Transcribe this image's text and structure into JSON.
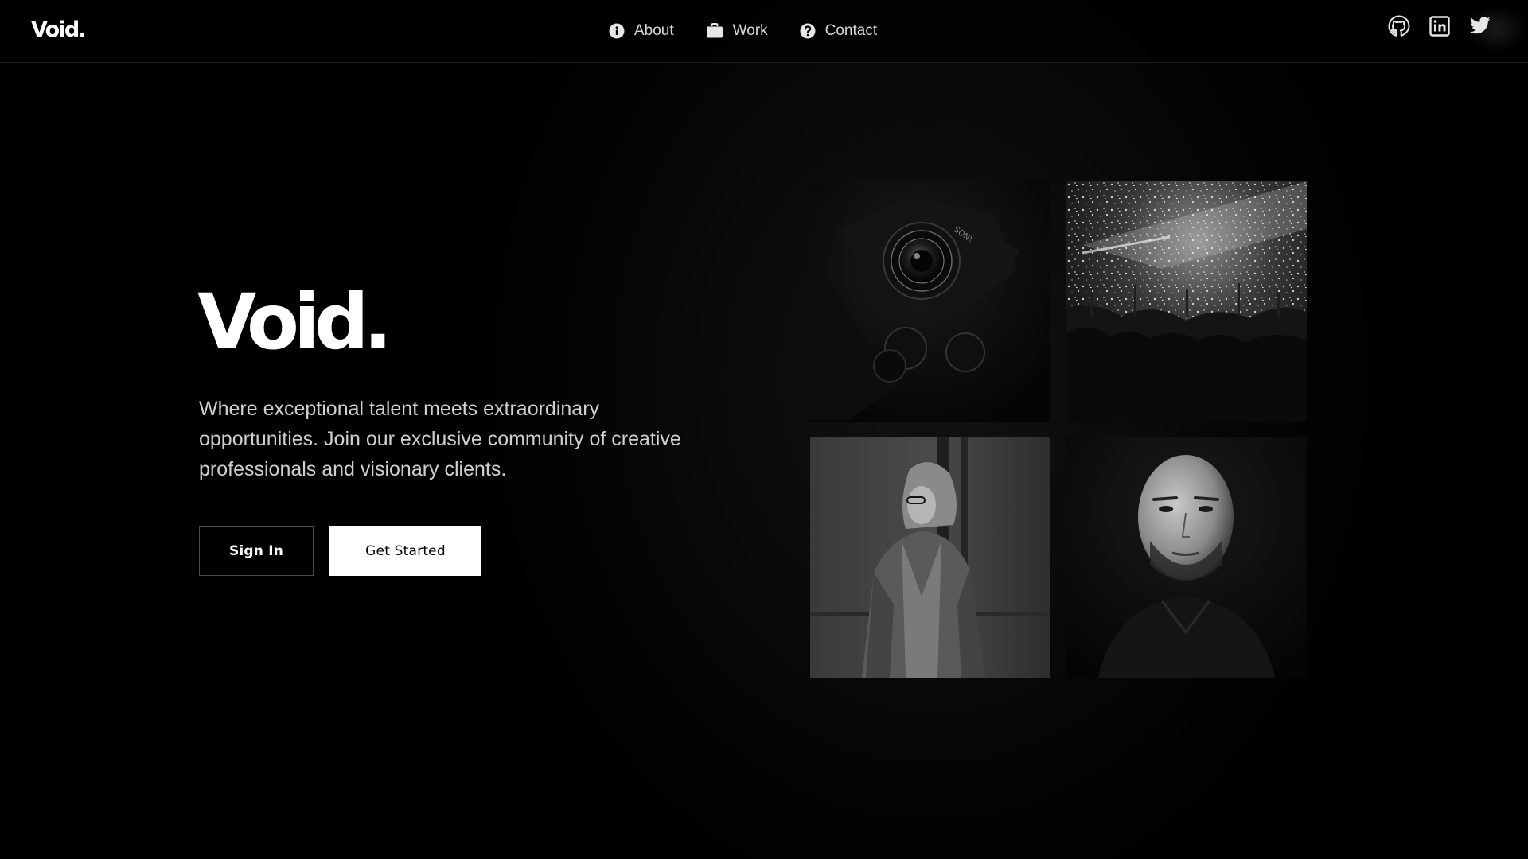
{
  "brand": {
    "logo_text": "Void."
  },
  "nav": {
    "items": [
      {
        "label": "About",
        "icon": "info-icon"
      },
      {
        "label": "Work",
        "icon": "briefcase-icon"
      },
      {
        "label": "Contact",
        "icon": "question-icon"
      }
    ]
  },
  "socials": [
    {
      "icon": "github-icon"
    },
    {
      "icon": "linkedin-icon"
    },
    {
      "icon": "twitter-icon"
    }
  ],
  "hero": {
    "title": "Void.",
    "description": "Where exceptional talent meets extraordinary opportunities. Join our exclusive community of creative professionals and visionary clients.",
    "sign_in_label": "Sign In",
    "get_started_label": "Get Started"
  },
  "gallery": {
    "tiles": [
      {
        "subject": "camera"
      },
      {
        "subject": "concert-crowd"
      },
      {
        "subject": "woman-in-hoodie"
      },
      {
        "subject": "man-portrait"
      }
    ]
  },
  "colors": {
    "background": "#000000",
    "text": "#ffffff",
    "muted_text": "#cfcfcf",
    "nav_text": "#d9d9d9"
  }
}
